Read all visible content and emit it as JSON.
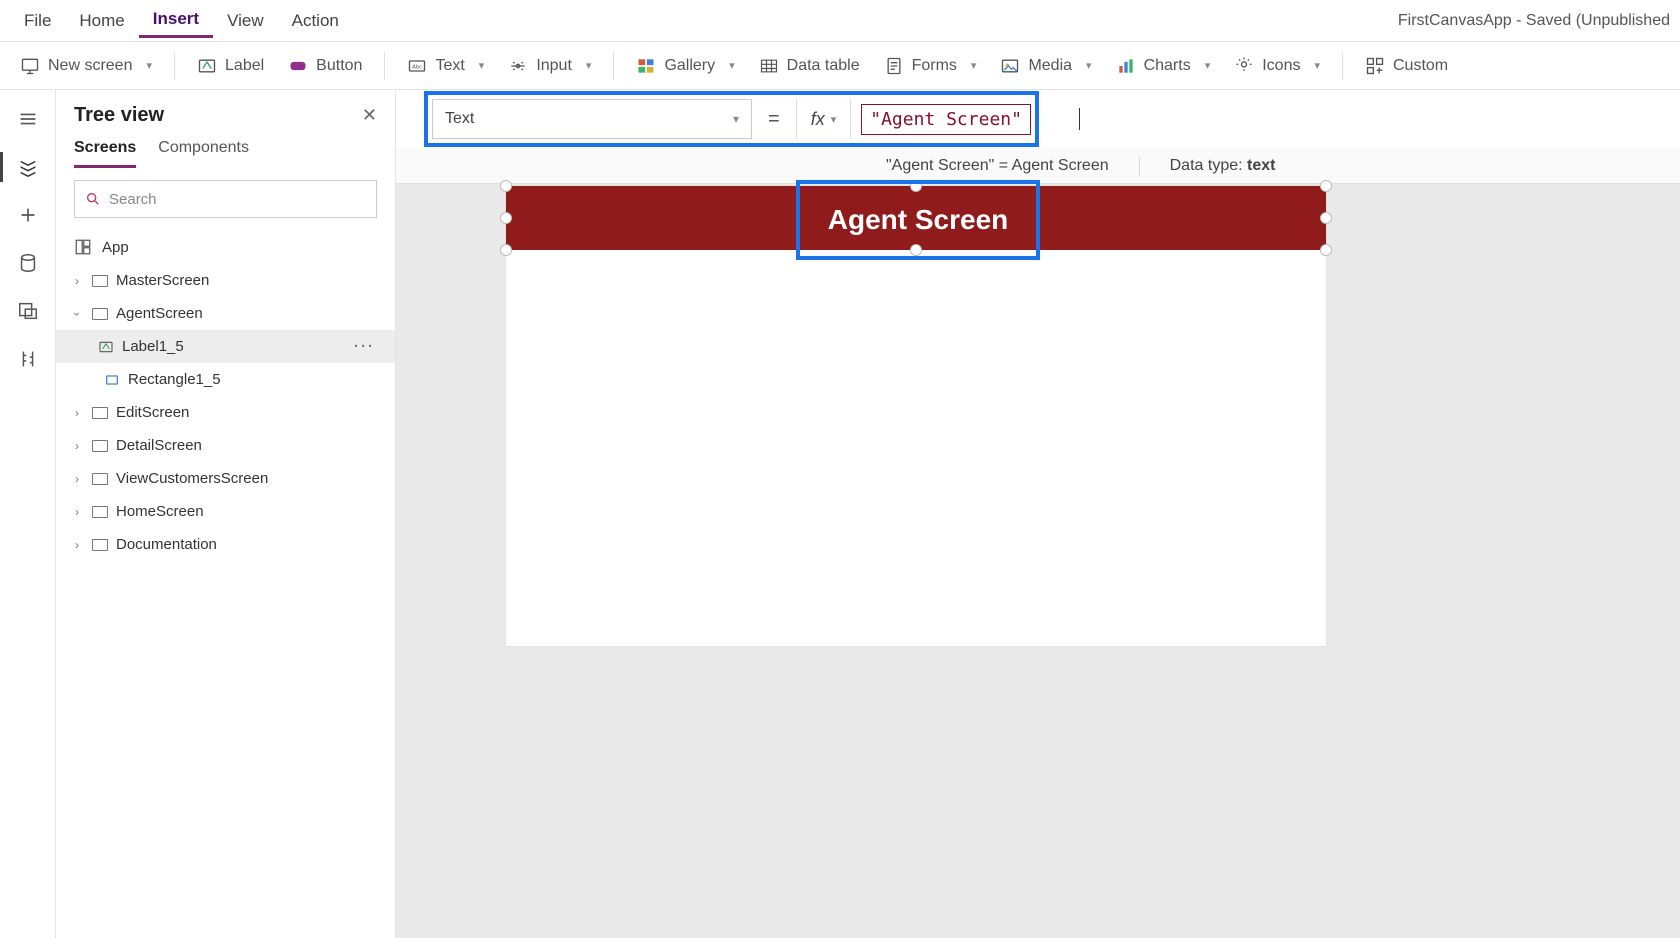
{
  "app_title": "FirstCanvasApp - Saved (Unpublished",
  "top_menu": {
    "file": "File",
    "home": "Home",
    "insert": "Insert",
    "view": "View",
    "action": "Action"
  },
  "ribbon": {
    "new_screen": "New screen",
    "label": "Label",
    "button": "Button",
    "text": "Text",
    "input": "Input",
    "gallery": "Gallery",
    "data_table": "Data table",
    "forms": "Forms",
    "media": "Media",
    "charts": "Charts",
    "icons": "Icons",
    "custom": "Custom"
  },
  "formula": {
    "property": "Text",
    "fx": "fx",
    "value_quoted": "\"Agent Screen\"",
    "result_left": "\"Agent Screen\"  =  Agent Screen",
    "data_type_label": "Data type: ",
    "data_type_value": "text"
  },
  "tree": {
    "title": "Tree view",
    "tab_screens": "Screens",
    "tab_components": "Components",
    "search_placeholder": "Search",
    "app": "App",
    "nodes": {
      "master": "MasterScreen",
      "agent": "AgentScreen",
      "label": "Label1_5",
      "rect": "Rectangle1_5",
      "edit": "EditScreen",
      "detail": "DetailScreen",
      "viewc": "ViewCustomersScreen",
      "home": "HomeScreen",
      "doc": "Documentation"
    }
  },
  "canvas": {
    "label_text": "Agent Screen"
  }
}
